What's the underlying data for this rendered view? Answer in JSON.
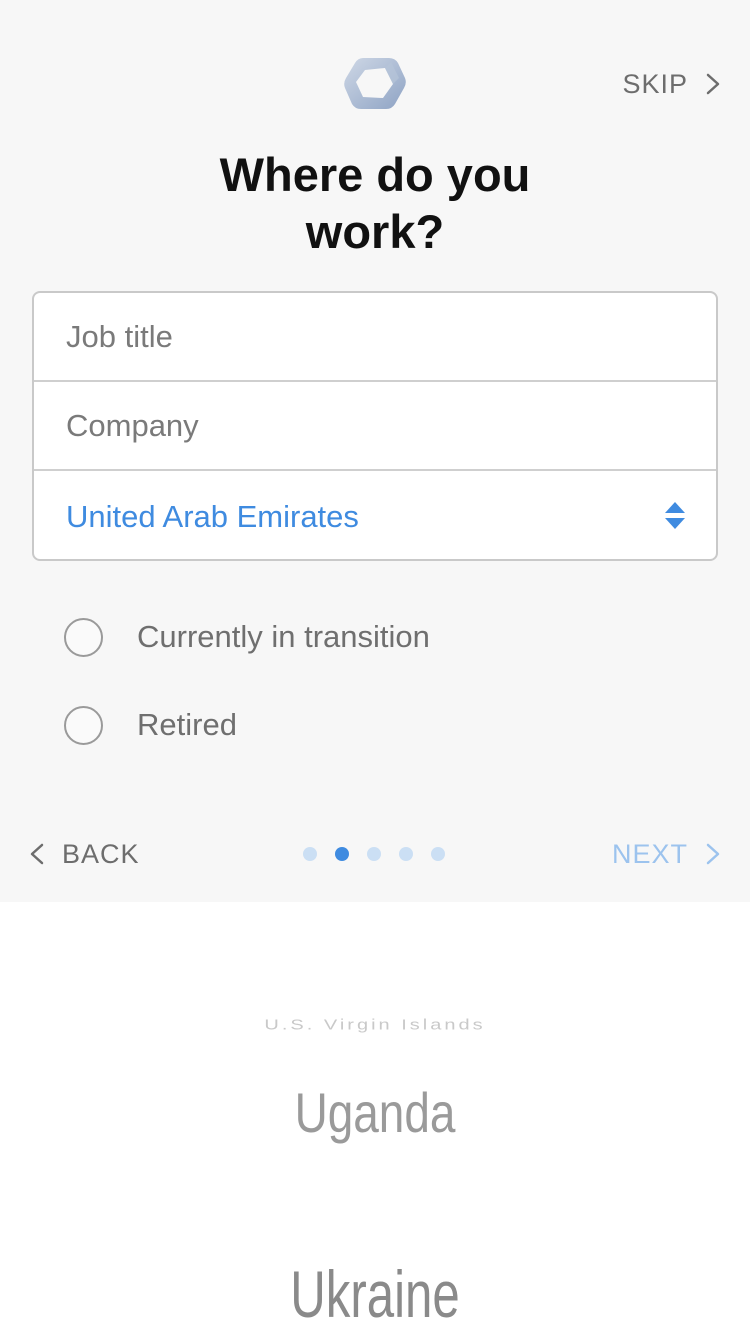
{
  "header": {
    "skip_label": "SKIP"
  },
  "title": {
    "line1": "Where do you",
    "line2": "work?"
  },
  "form": {
    "job_title_placeholder": "Job title",
    "company_placeholder": "Company",
    "country_value": "United Arab Emirates"
  },
  "options": [
    {
      "label": "Currently in transition",
      "selected": false
    },
    {
      "label": "Retired",
      "selected": false
    }
  ],
  "footer": {
    "back_label": "BACK",
    "next_label": "NEXT",
    "page_count": 5,
    "current_page": 2
  },
  "picker": {
    "items": [
      "U.S. Virgin Islands",
      "Uganda",
      "Ukraine"
    ]
  },
  "colors": {
    "accent": "#3f8be0",
    "next_disabled": "#9cc3ee",
    "background": "#f7f7f7"
  },
  "icons": [
    "app-logo-icon",
    "chevron-right-icon",
    "chevron-left-icon",
    "up-down-stepper-icon"
  ]
}
